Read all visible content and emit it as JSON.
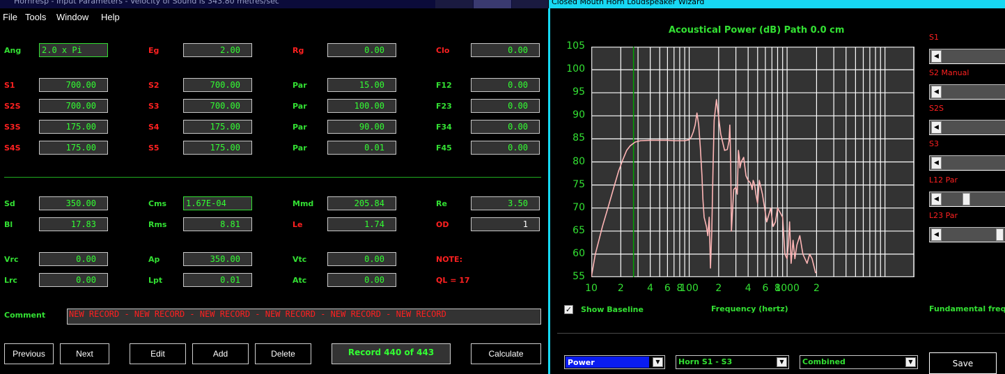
{
  "left_window": {
    "title": "Hornresp - Input Parameters - Velocity of Sound is 343.80 metres/sec"
  },
  "right_window": {
    "title": "Closed Mouth Horn Loudspeaker Wizard"
  },
  "menu": [
    "File",
    "Tools",
    "Window",
    "Help"
  ],
  "params": [
    {
      "label": "Ang",
      "value": "2.0 x Pi",
      "lc": "g"
    },
    {
      "label": "Eg",
      "value": "2.00",
      "lc": "r"
    },
    {
      "label": "Rg",
      "value": "0.00",
      "lc": "r"
    },
    {
      "label": "Clo",
      "value": "0.00",
      "lc": "r"
    },
    {
      "label": "S1",
      "value": "700.00",
      "lc": "r"
    },
    {
      "label": "S2",
      "value": "700.00",
      "lc": "r"
    },
    {
      "label": "Par",
      "value": "15.00",
      "lc": "g"
    },
    {
      "label": "F12",
      "value": "0.00",
      "lc": "g"
    },
    {
      "label": "S2S",
      "value": "700.00",
      "lc": "r"
    },
    {
      "label": "S3",
      "value": "700.00",
      "lc": "r"
    },
    {
      "label": "Par",
      "value": "100.00",
      "lc": "g"
    },
    {
      "label": "F23",
      "value": "0.00",
      "lc": "g"
    },
    {
      "label": "S3S",
      "value": "175.00",
      "lc": "r"
    },
    {
      "label": "S4",
      "value": "175.00",
      "lc": "r"
    },
    {
      "label": "Par",
      "value": "90.00",
      "lc": "g"
    },
    {
      "label": "F34",
      "value": "0.00",
      "lc": "g"
    },
    {
      "label": "S4S",
      "value": "175.00",
      "lc": "r"
    },
    {
      "label": "S5",
      "value": "175.00",
      "lc": "r"
    },
    {
      "label": "Par",
      "value": "0.01",
      "lc": "g"
    },
    {
      "label": "F45",
      "value": "0.00",
      "lc": "g"
    },
    {
      "label": "Sd",
      "value": "350.00",
      "lc": "g"
    },
    {
      "label": "Cms",
      "value": "1.67E-04",
      "lc": "g"
    },
    {
      "label": "Mmd",
      "value": "205.84",
      "lc": "g"
    },
    {
      "label": "Re",
      "value": "3.50",
      "lc": "g"
    },
    {
      "label": "Bl",
      "value": "17.83",
      "lc": "g"
    },
    {
      "label": "Rms",
      "value": "8.81",
      "lc": "g"
    },
    {
      "label": "Le",
      "value": "1.74",
      "lc": "r"
    },
    {
      "label": "OD",
      "value": "1",
      "lc": "r"
    },
    {
      "label": "Vrc",
      "value": "0.00",
      "lc": "g"
    },
    {
      "label": "Ap",
      "value": "350.00",
      "lc": "g"
    },
    {
      "label": "Vtc",
      "value": "0.00",
      "lc": "g"
    },
    {
      "label": "NOTE:",
      "value": "",
      "lc": "r"
    },
    {
      "label": "Lrc",
      "value": "0.00",
      "lc": "g"
    },
    {
      "label": "Lpt",
      "value": "0.01",
      "lc": "g"
    },
    {
      "label": "Atc",
      "value": "0.00",
      "lc": "g"
    },
    {
      "label": "QL = 17",
      "value": "",
      "lc": "r"
    }
  ],
  "comment": {
    "label": "Comment",
    "value": "NEW RECORD - NEW RECORD - NEW RECORD - NEW RECORD - NEW RECORD - NEW RECORD"
  },
  "buttons": {
    "previous": "Previous",
    "next": "Next",
    "edit": "Edit",
    "add": "Add",
    "delete": "Delete",
    "calculate": "Calculate"
  },
  "record": "Record 440 of 443",
  "sliders": [
    {
      "label": "S1",
      "pos": 0.0
    },
    {
      "label": "S2 Manual",
      "pos": 0.0
    },
    {
      "label": "S2S",
      "pos": 0.0
    },
    {
      "label": "S3",
      "pos": 0.0
    },
    {
      "label": "L12 Par",
      "pos": 0.38
    },
    {
      "label": "L23 Par",
      "pos": 1.0
    }
  ],
  "show_baseline": {
    "label": "Show Baseline",
    "checked": true
  },
  "xaxis_label": "Frequency (hertz)",
  "fundamental_label": "Fundamental freq is",
  "combos": {
    "mode": "Power",
    "horn": "Horn S1 - S3",
    "output": "Combined"
  },
  "save_label": "Save",
  "colors": {
    "curve": "#ffb6b6",
    "grid": "#ffffff",
    "axis_text": "#33e033",
    "marker": "#00a000",
    "plot_bg": "#333333"
  },
  "chart_data": {
    "type": "line",
    "title": "Acoustical Power (dB)   Path 0.0 cm",
    "xlabel": "Frequency (hertz)",
    "ylabel": "",
    "xscale": "log",
    "xlim": [
      10,
      20000
    ],
    "ylim": [
      55,
      105
    ],
    "yticks": [
      55,
      60,
      65,
      70,
      75,
      80,
      85,
      90,
      95,
      100,
      105
    ],
    "xticks": [
      {
        "v": 10,
        "l": "10"
      },
      {
        "v": 20,
        "l": "2"
      },
      {
        "v": 40,
        "l": "4"
      },
      {
        "v": 60,
        "l": "6"
      },
      {
        "v": 80,
        "l": "8"
      },
      {
        "v": 100,
        "l": "100"
      },
      {
        "v": 200,
        "l": "2"
      },
      {
        "v": 400,
        "l": "4"
      },
      {
        "v": 600,
        "l": "6"
      },
      {
        "v": 800,
        "l": "8"
      },
      {
        "v": 1000,
        "l": "1000"
      },
      {
        "v": 2000,
        "l": "2"
      }
    ],
    "marker_x": 27,
    "grid": true,
    "series": [
      {
        "x": [
          10,
          11,
          13,
          15,
          17,
          19,
          21,
          23,
          25,
          28,
          32,
          40,
          50,
          60,
          70,
          80,
          90,
          100,
          105,
          110,
          115,
          120,
          125,
          130,
          135,
          138,
          142,
          150,
          155,
          160,
          165,
          170,
          175,
          180,
          190,
          210,
          230,
          245,
          255,
          260,
          262,
          265,
          270,
          285,
          300,
          310,
          318,
          325,
          330,
          340,
          360,
          380,
          400,
          420,
          430,
          440,
          450,
          460,
          470,
          480,
          500,
          520,
          560,
          620,
          680,
          720,
          760,
          800,
          850,
          900,
          950,
          1000,
          1030,
          1060,
          1100,
          1150,
          1200,
          1260,
          1350,
          1450,
          1600,
          1700,
          1800,
          1950,
          2000
        ],
        "y": [
          55,
          60,
          66,
          70.5,
          74.5,
          78,
          80.5,
          82.5,
          83.5,
          84.3,
          84.6,
          84.7,
          84.7,
          84.7,
          84.6,
          84.6,
          84.6,
          84.8,
          85.4,
          86.5,
          88,
          90.6,
          88,
          83,
          77,
          72,
          68,
          66,
          64,
          68,
          57,
          65,
          78,
          89,
          93.5,
          86,
          82.5,
          82.7,
          84.5,
          88,
          85,
          80,
          65,
          74,
          74.5,
          73,
          82.5,
          81,
          78.7,
          80,
          81,
          77,
          76,
          75.5,
          75,
          74,
          76,
          75.5,
          74.5,
          73,
          71,
          76,
          73,
          67,
          70,
          66,
          67,
          70,
          69,
          68,
          60,
          59,
          62,
          67,
          58,
          63,
          59,
          62,
          64,
          60,
          58,
          60,
          59,
          56,
          56
        ]
      }
    ]
  }
}
